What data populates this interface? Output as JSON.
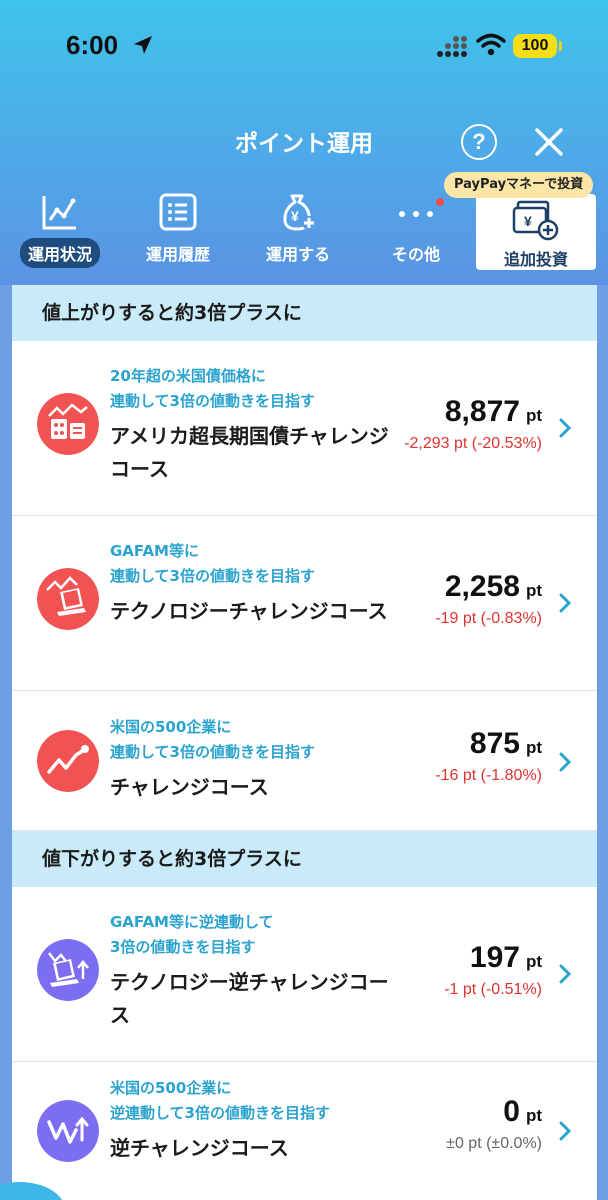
{
  "status_bar": {
    "time": "6:00",
    "battery": "100"
  },
  "nav": {
    "title": "ポイント運用"
  },
  "tabs": [
    {
      "label": "運用状況",
      "active": true
    },
    {
      "label": "運用履歴"
    },
    {
      "label": "運用する"
    },
    {
      "label": "その他"
    }
  ],
  "add_invest": {
    "label": "追加投資",
    "badge": "PayPayマネーで投資"
  },
  "sections": [
    {
      "title": "値上がりすると約3倍プラスに",
      "courses": [
        {
          "desc_line1": "20年超の米国債価格に",
          "desc_line2": "連動して3倍の値動きを目指す",
          "name": "アメリカ超長期国債チャレンジコース",
          "points": "8,877",
          "unit": "pt",
          "change": "-2,293 pt (-20.53%)",
          "icon": "treasury-building-icon",
          "color": "#f15353"
        },
        {
          "desc_line1": "GAFAM等に",
          "desc_line2": "連動して3倍の値動きを目指す",
          "name": "テクノロジーチャレンジコース",
          "points": "2,258",
          "unit": "pt",
          "change": "-19 pt (-0.83%)",
          "icon": "laptop-chart-icon",
          "color": "#f15353"
        },
        {
          "desc_line1": "米国の500企業に",
          "desc_line2": "連動して3倍の値動きを目指す",
          "name": "チャレンジコース",
          "points": "875",
          "unit": "pt",
          "change": "-16 pt (-1.80%)",
          "icon": "trend-up-icon",
          "color": "#f15353"
        }
      ]
    },
    {
      "title": "値下がりすると約3倍プラスに",
      "courses": [
        {
          "desc_line1": "GAFAM等に逆連動して",
          "desc_line2": "3倍の値動きを目指す",
          "name": "テクノロジー逆チャレンジコース",
          "points": "197",
          "unit": "pt",
          "change": "-1 pt (-0.51%)",
          "icon": "laptop-reverse-icon",
          "color": "#7b6ef0"
        },
        {
          "desc_line1": "米国の500企業に",
          "desc_line2": "逆連動して3倍の値動きを目指す",
          "name": "逆チャレンジコース",
          "points": "0",
          "unit": "pt",
          "change": "±0 pt (±0.0%)",
          "icon": "trend-reverse-icon",
          "color": "#7b6ef0"
        }
      ]
    }
  ]
}
